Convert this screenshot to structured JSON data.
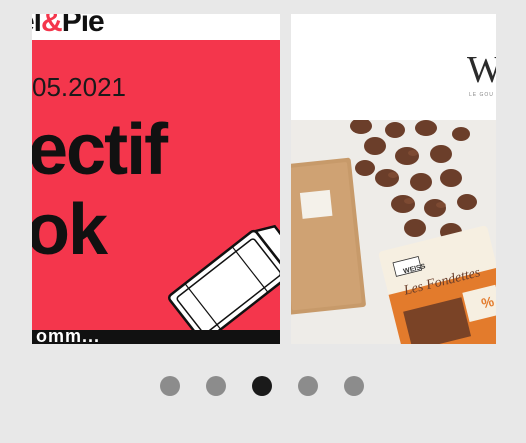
{
  "carousel": {
    "slides": [
      {
        "brand": "el",
        "brand_amp": "&",
        "brand_tail": "Pie",
        "date": "05.2021",
        "headline_line1": "ectif",
        "headline_line2": "ok",
        "footer_text": "omm..."
      },
      {
        "logo": "W",
        "logo_sub": "LE GOU",
        "package_brand": "WEISS",
        "package_title": "Les Fondettes",
        "package_percent": "%"
      }
    ],
    "pagination": {
      "count": 5,
      "active_index": 2
    }
  },
  "colors": {
    "background": "#e8e8e8",
    "poster_red": "#f4364c",
    "dot_inactive": "#8c8c8c",
    "dot_active": "#1a1a1a"
  }
}
